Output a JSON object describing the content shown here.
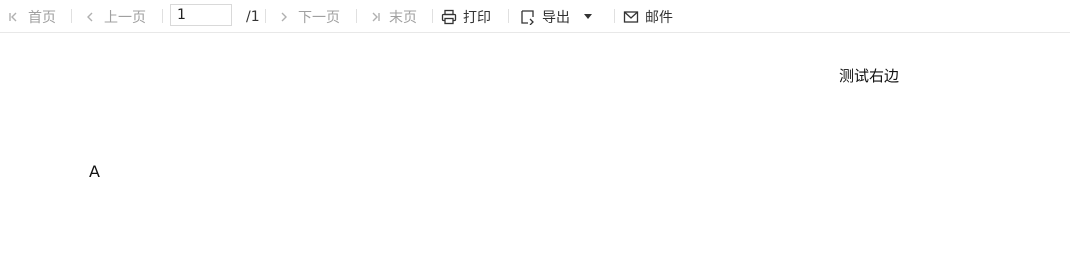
{
  "toolbar": {
    "first_page": "首页",
    "prev_page": "上一页",
    "page_value": "1",
    "page_total": "/1",
    "next_page": "下一页",
    "last_page": "末页",
    "print": "打印",
    "export": "导出",
    "mail": "邮件"
  },
  "content": {
    "right_text": "测试右边",
    "left_text": "A"
  },
  "icons": {
    "first": "first-page-icon",
    "prev": "chevron-left-icon",
    "next": "chevron-right-icon",
    "last": "last-page-icon",
    "print": "printer-icon",
    "export": "export-icon",
    "dropdown": "caret-down-icon",
    "mail": "mail-icon"
  }
}
